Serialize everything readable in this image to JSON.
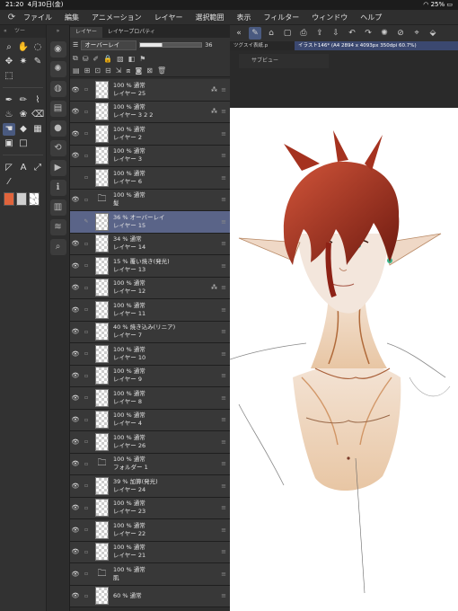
{
  "status_bar": {
    "time": "21:20",
    "date": "4月30日(金)",
    "battery": "25%"
  },
  "menu": {
    "items": [
      "ファイル",
      "編集",
      "アニメーション",
      "レイヤー",
      "選択範囲",
      "表示",
      "フィルター",
      "ウィンドウ",
      "ヘルプ"
    ]
  },
  "tool_panel": {
    "header": "ツー"
  },
  "layer_panel": {
    "tabs": [
      "レイヤー",
      "レイヤープロパティ"
    ],
    "blend_mode": "オーバーレイ",
    "opacity": "36",
    "opacity_fraction": 0.36
  },
  "canvas": {
    "tabs": [
      "ツグスイ表紙.p",
      "イラスト146* (A4 2894 x 4093px 350dpi 60.7%)"
    ],
    "subview_label": "サブビュー"
  },
  "layers": [
    {
      "mode": "100 % 通常",
      "name": "レイヤー 25",
      "kind": "layer",
      "visible": true,
      "mark": "⁂"
    },
    {
      "mode": "100 % 通常",
      "name": "レイヤー 3 2 2",
      "kind": "layer",
      "visible": true,
      "mark": "⁂"
    },
    {
      "mode": "100 % 通常",
      "name": "レイヤー 2",
      "kind": "layer",
      "visible": true,
      "mark": ""
    },
    {
      "mode": "100 % 通常",
      "name": "レイヤー 3",
      "kind": "layer",
      "visible": true,
      "mark": ""
    },
    {
      "mode": "100 % 通常",
      "name": "レイヤー 6",
      "kind": "layer",
      "visible": false,
      "mark": ""
    },
    {
      "mode": "100 % 通常",
      "name": "髪",
      "kind": "folder",
      "visible": true,
      "mark": ""
    },
    {
      "mode": "36 % オーバーレイ",
      "name": "レイヤー 15",
      "kind": "layer",
      "visible": false,
      "mark": "",
      "selected": true
    },
    {
      "mode": "34 % 通常",
      "name": "レイヤー 14",
      "kind": "layer",
      "visible": true,
      "mark": ""
    },
    {
      "mode": "15 % 覆い焼き(発光)",
      "name": "レイヤー 13",
      "kind": "layer",
      "visible": true,
      "mark": ""
    },
    {
      "mode": "100 % 通常",
      "name": "レイヤー 12",
      "kind": "layer",
      "visible": true,
      "mark": "⁂"
    },
    {
      "mode": "100 % 通常",
      "name": "レイヤー 11",
      "kind": "layer",
      "visible": true,
      "mark": ""
    },
    {
      "mode": "40 % 焼き込み(リニア)",
      "name": "レイヤー 7",
      "kind": "layer",
      "visible": true,
      "mark": ""
    },
    {
      "mode": "100 % 通常",
      "name": "レイヤー 10",
      "kind": "layer",
      "visible": true,
      "mark": ""
    },
    {
      "mode": "100 % 通常",
      "name": "レイヤー 9",
      "kind": "layer",
      "visible": true,
      "mark": ""
    },
    {
      "mode": "100 % 通常",
      "name": "レイヤー 8",
      "kind": "layer",
      "visible": true,
      "mark": ""
    },
    {
      "mode": "100 % 通常",
      "name": "レイヤー 4",
      "kind": "layer",
      "visible": true,
      "mark": ""
    },
    {
      "mode": "100 % 通常",
      "name": "レイヤー 26",
      "kind": "layer",
      "visible": true,
      "mark": ""
    },
    {
      "mode": "100 % 通常",
      "name": "フォルダー 1",
      "kind": "folder",
      "visible": true,
      "mark": ""
    },
    {
      "mode": "39 % 加算(発光)",
      "name": "レイヤー 24",
      "kind": "layer",
      "visible": true,
      "mark": ""
    },
    {
      "mode": "100 % 通常",
      "name": "レイヤー 23",
      "kind": "layer",
      "visible": true,
      "mark": ""
    },
    {
      "mode": "100 % 通常",
      "name": "レイヤー 22",
      "kind": "layer",
      "visible": true,
      "mark": ""
    },
    {
      "mode": "100 % 通常",
      "name": "レイヤー 21",
      "kind": "layer",
      "visible": true,
      "mark": ""
    },
    {
      "mode": "100 % 通常",
      "name": "肌",
      "kind": "folder",
      "visible": true,
      "mark": ""
    },
    {
      "mode": "60 % 通常",
      "name": "",
      "kind": "layer",
      "visible": true,
      "mark": ""
    }
  ],
  "colors": {
    "accent": "#5a6488",
    "main_color": "#e0643c"
  }
}
